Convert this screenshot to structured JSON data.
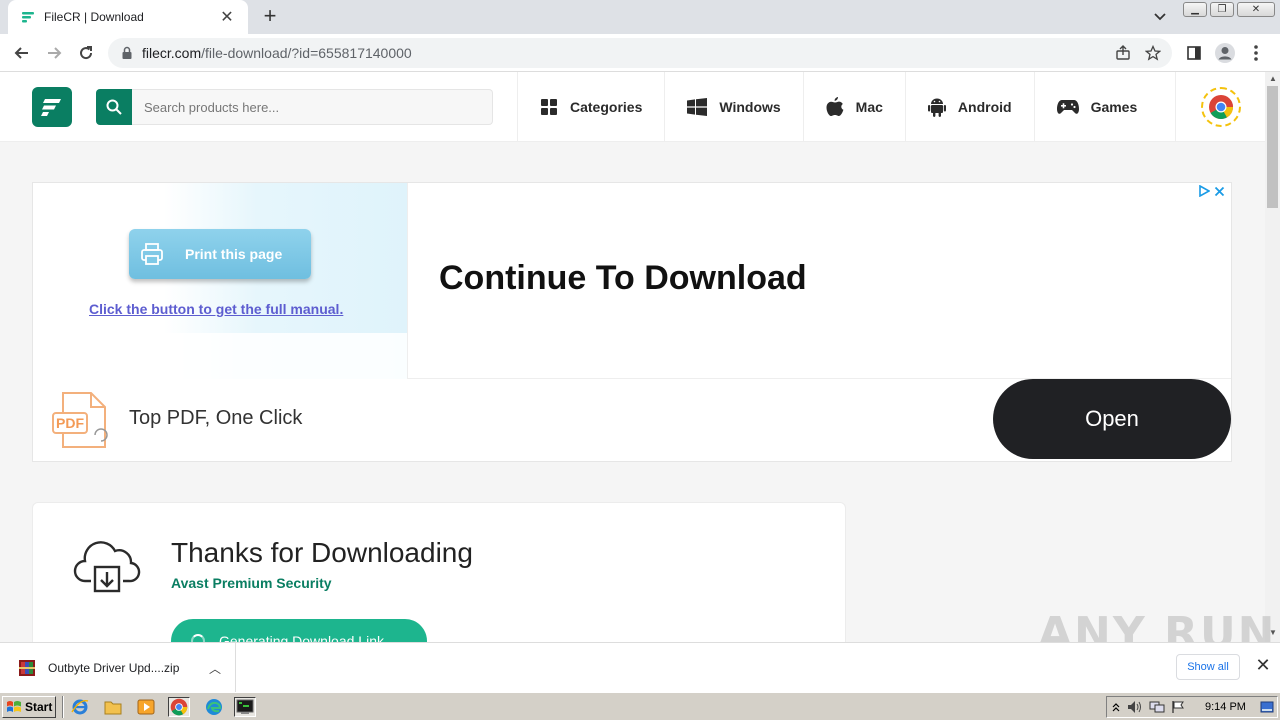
{
  "browser": {
    "tab_title": "FileCR | Download",
    "url_host": "filecr.com",
    "url_path": "/file-download/?id=655817140000"
  },
  "site": {
    "search_placeholder": "Search products here...",
    "nav": [
      {
        "label": "Categories",
        "icon": "grid-icon"
      },
      {
        "label": "Windows",
        "icon": "windows-icon"
      },
      {
        "label": "Mac",
        "icon": "apple-icon"
      },
      {
        "label": "Android",
        "icon": "android-icon"
      },
      {
        "label": "Games",
        "icon": "gamepad-icon"
      }
    ],
    "brand_color": "#0a7e62"
  },
  "ad": {
    "print_button": "Print this page",
    "manual_link": "Click the button to get the full manual.",
    "headline": "Continue To Download",
    "bottom_text": "Top PDF, One Click",
    "open_button": "Open",
    "pdf_badge": "PDF"
  },
  "card": {
    "title": "Thanks for Downloading",
    "subtitle": "Avast Premium Security",
    "button": "Generating Download Link"
  },
  "watermark": "ANY RUN",
  "downloads": {
    "file_name": "Outbyte Driver Upd....zip",
    "show_all": "Show all"
  },
  "taskbar": {
    "start_label": "Start",
    "clock": "9:14 PM"
  }
}
